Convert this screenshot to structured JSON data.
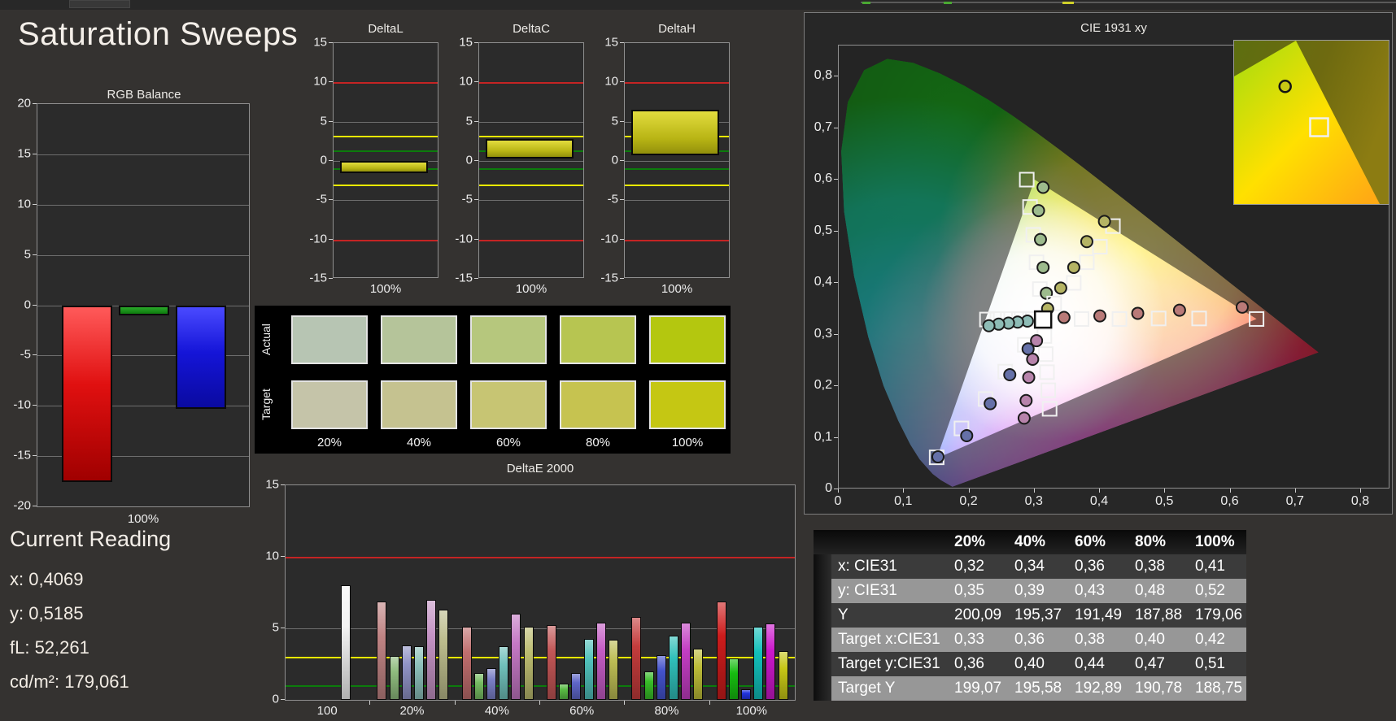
{
  "app": {
    "title": "Saturation Sweeps"
  },
  "current_reading": {
    "title": "Current Reading",
    "x": "x: 0,4069",
    "y": "y: 0,5185",
    "fl": "fL: 52,261",
    "cd": "cd/m²: 179,061"
  },
  "chart_data": {
    "rgb_balance": {
      "type": "bar",
      "title": "RGB Balance",
      "xlabel": "100%",
      "ylim": [
        -20,
        20
      ],
      "yticks": [
        20,
        15,
        10,
        5,
        0,
        -5,
        -10,
        -15,
        -20
      ],
      "categories": [
        "Red",
        "Green",
        "Blue"
      ],
      "values": [
        -17.6,
        -1.0,
        -10.3
      ],
      "colors": [
        "red",
        "green",
        "blue"
      ]
    },
    "delta_charts": {
      "ylim": [
        -15,
        15
      ],
      "yticks": [
        15,
        10,
        5,
        0,
        -5,
        -10,
        -15
      ],
      "limits": {
        "red_hi": 10,
        "red_lo": -10,
        "yellow_hi": 3.2,
        "yellow_lo": -3.0,
        "green_hi": 1.3,
        "green_lo": -0.9
      },
      "xlabel": "100%",
      "charts": [
        {
          "title": "DeltaL",
          "bar_from": 0.0,
          "bar_to": -1.55
        },
        {
          "title": "DeltaC",
          "bar_from": 0.35,
          "bar_to": 2.75
        },
        {
          "title": "DeltaH",
          "bar_from": 0.7,
          "bar_to": 6.5
        }
      ]
    },
    "swatches": {
      "row_labels": [
        "Actual",
        "Target"
      ],
      "col_labels": [
        "20%",
        "40%",
        "60%",
        "80%",
        "100%"
      ],
      "actual_colors": [
        "#b7c5b3",
        "#b5c49a",
        "#b6c77d",
        "#b7c551",
        "#b4c70f"
      ],
      "target_colors": [
        "#c5c4a9",
        "#c5c290",
        "#c7c573",
        "#c6c350",
        "#c5c713"
      ]
    },
    "deltae2000": {
      "type": "bar",
      "title": "DeltaE 2000",
      "ylim": [
        0,
        15
      ],
      "yticks": [
        15,
        10,
        5,
        0
      ],
      "limits": {
        "red": 10,
        "yellow": 3,
        "green": 1
      },
      "groups": [
        {
          "label": "100",
          "values": [
            8.0
          ],
          "colors": [
            "#f4f4f4"
          ],
          "align": "right"
        },
        {
          "label": "20%",
          "values": [
            6.9,
            3.05,
            3.8,
            3.75,
            7.0,
            6.3
          ],
          "colors": [
            "#c08484",
            "#8fbc7e",
            "#9093c6",
            "#8cc0ba",
            "#c493c4",
            "#bcbc8c"
          ]
        },
        {
          "label": "40%",
          "values": [
            5.1,
            1.85,
            2.2,
            3.75,
            6.0,
            5.1
          ],
          "colors": [
            "#c06e6e",
            "#76bc62",
            "#7a7fc6",
            "#70c0ba",
            "#c478c4",
            "#bcbc70"
          ]
        },
        {
          "label": "60%",
          "values": [
            5.2,
            1.15,
            1.9,
            4.25,
            5.4,
            4.2
          ],
          "colors": [
            "#c25656",
            "#58bc44",
            "#5e66c8",
            "#50c0ba",
            "#c45cc4",
            "#bcbc54"
          ]
        },
        {
          "label": "80%",
          "values": [
            5.8,
            2.0,
            3.1,
            4.5,
            5.4,
            3.6
          ],
          "colors": [
            "#c43c3c",
            "#38bc28",
            "#4352cc",
            "#30c0ba",
            "#c43ec4",
            "#bcbc38"
          ]
        },
        {
          "label": "100%",
          "values": [
            6.9,
            2.9,
            0.75,
            5.1,
            5.35,
            3.4
          ],
          "colors": [
            "#cc1c1c",
            "#16bc10",
            "#2233dd",
            "#12c0ba",
            "#cc18cc",
            "#c6c616"
          ]
        }
      ]
    },
    "cie": {
      "type": "scatter",
      "title": "CIE 1931 xy",
      "xtick_labels": [
        "0",
        "0,1",
        "0,2",
        "0,3",
        "0,4",
        "0,5",
        "0,6",
        "0,7",
        "0,8"
      ],
      "ytick_labels": [
        "0",
        "0,1",
        "0,2",
        "0,3",
        "0,4",
        "0,5",
        "0,6",
        "0,7",
        "0,8"
      ],
      "white_point": [
        0.313,
        0.329
      ],
      "gamut_triangle": [
        [
          0.64,
          0.33
        ],
        [
          0.3,
          0.6
        ],
        [
          0.15,
          0.06
        ]
      ],
      "sweeps": [
        {
          "name": "red",
          "dot_color": "#b97a78",
          "targets": [
            [
              0.372,
              0.33
            ],
            [
              0.43,
              0.33
            ],
            [
              0.49,
              0.331
            ],
            [
              0.552,
              0.331
            ],
            [
              0.64,
              0.33
            ]
          ],
          "measured": [
            [
              0.345,
              0.333
            ],
            [
              0.4,
              0.336
            ],
            [
              0.458,
              0.341
            ],
            [
              0.522,
              0.347
            ],
            [
              0.618,
              0.353
            ]
          ]
        },
        {
          "name": "green",
          "dot_color": "#9dbb8d",
          "targets": [
            [
              0.308,
              0.388
            ],
            [
              0.303,
              0.44
            ],
            [
              0.298,
              0.493
            ],
            [
              0.293,
              0.547
            ],
            [
              0.288,
              0.6
            ]
          ],
          "measured": [
            [
              0.318,
              0.38
            ],
            [
              0.313,
              0.43
            ],
            [
              0.309,
              0.484
            ],
            [
              0.306,
              0.54
            ],
            [
              0.313,
              0.585
            ]
          ]
        },
        {
          "name": "blue",
          "dot_color": "#6570a8",
          "targets": [
            [
              0.285,
              0.28
            ],
            [
              0.255,
              0.228
            ],
            [
              0.225,
              0.175
            ],
            [
              0.188,
              0.118
            ],
            [
              0.15,
              0.062
            ]
          ],
          "measured": [
            [
              0.29,
              0.272
            ],
            [
              0.262,
              0.222
            ],
            [
              0.232,
              0.166
            ],
            [
              0.196,
              0.104
            ],
            [
              0.152,
              0.063
            ]
          ]
        },
        {
          "name": "cyan",
          "dot_color": "#8ebcb6",
          "targets": [
            [
              0.293,
              0.33
            ],
            [
              0.276,
              0.33
            ],
            [
              0.259,
              0.33
            ],
            [
              0.243,
              0.33
            ],
            [
              0.227,
              0.329
            ]
          ],
          "measured": [
            [
              0.289,
              0.326
            ],
            [
              0.274,
              0.324
            ],
            [
              0.26,
              0.322
            ],
            [
              0.245,
              0.32
            ],
            [
              0.23,
              0.317
            ]
          ]
        },
        {
          "name": "magenta",
          "dot_color": "#b783ab",
          "targets": [
            [
              0.315,
              0.297
            ],
            [
              0.317,
              0.262
            ],
            [
              0.319,
              0.227
            ],
            [
              0.321,
              0.192
            ],
            [
              0.323,
              0.156
            ]
          ],
          "measured": [
            [
              0.303,
              0.288
            ],
            [
              0.297,
              0.252
            ],
            [
              0.291,
              0.217
            ],
            [
              0.287,
              0.172
            ],
            [
              0.284,
              0.138
            ]
          ]
        },
        {
          "name": "yellow",
          "dot_color": "#b5b464",
          "targets": [
            [
              0.33,
              0.36
            ],
            [
              0.36,
              0.4
            ],
            [
              0.38,
              0.44
            ],
            [
              0.4,
              0.47
            ],
            [
              0.42,
              0.51
            ]
          ],
          "measured": [
            [
              0.32,
              0.35
            ],
            [
              0.34,
              0.39
            ],
            [
              0.36,
              0.43
            ],
            [
              0.38,
              0.48
            ],
            [
              0.407,
              0.519
            ]
          ]
        }
      ],
      "inset": {
        "circle_pct": [
          33,
          28
        ],
        "square_pct": [
          55,
          53
        ]
      }
    },
    "table": {
      "columns": [
        "",
        "20%",
        "40%",
        "60%",
        "80%",
        "100%"
      ],
      "rows": [
        {
          "label": "x: CIE31",
          "values": [
            "0,32",
            "0,34",
            "0,36",
            "0,38",
            "0,41"
          ],
          "shade": "dark"
        },
        {
          "label": "y: CIE31",
          "values": [
            "0,35",
            "0,39",
            "0,43",
            "0,48",
            "0,52"
          ],
          "shade": "light"
        },
        {
          "label": "Y",
          "values": [
            "200,09",
            "195,37",
            "191,49",
            "187,88",
            "179,06"
          ],
          "shade": "dark"
        },
        {
          "label": "Target x:CIE31",
          "values": [
            "0,33",
            "0,36",
            "0,38",
            "0,40",
            "0,42"
          ],
          "shade": "light"
        },
        {
          "label": "Target y:CIE31",
          "values": [
            "0,36",
            "0,40",
            "0,44",
            "0,47",
            "0,51"
          ],
          "shade": "dark"
        },
        {
          "label": "Target Y",
          "values": [
            "199,07",
            "195,58",
            "192,89",
            "190,78",
            "188,75"
          ],
          "shade": "light"
        }
      ]
    }
  },
  "colors": {
    "background": "#343230",
    "panel": "#2b2b2b",
    "grid": "#6e6e6e",
    "limit_red": "#c42424",
    "limit_yellow": "#e8e800",
    "limit_green": "#0c7c0c",
    "olive_bar": "#c6c018"
  }
}
